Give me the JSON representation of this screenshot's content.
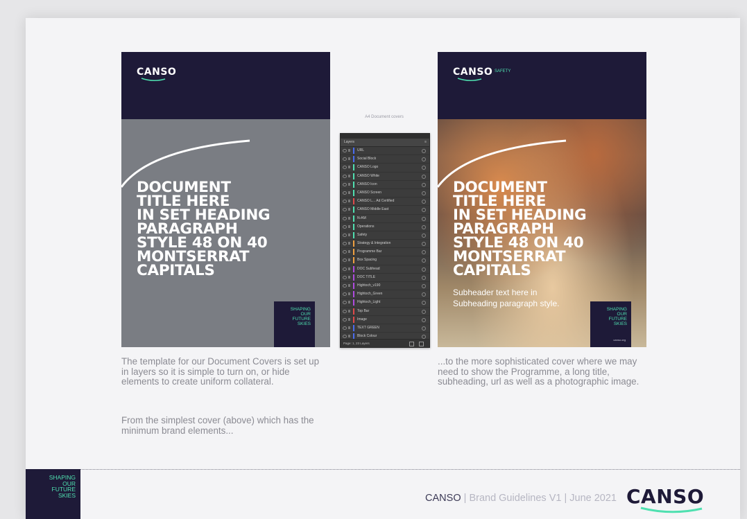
{
  "colors": {
    "navy": "#1e1a38",
    "green": "#4fe0b0",
    "cover_grey": "#7a7d83",
    "caption_grey": "#8b8b93"
  },
  "cover_simple": {
    "logo": "CANSO",
    "title": "DOCUMENT\nTITLE HERE\nIN SET HEADING\nPARAGRAPH\nSTYLE 48 ON 40\nMONTSERRAT\nCAPITALS",
    "badge": "SHAPING\nOUR\nFUTURE\nSKIES"
  },
  "cover_photo": {
    "logo": "CANSO",
    "logo_sub": "SAFETY",
    "title": "DOCUMENT\nTITLE HERE\nIN SET HEADING\nPARAGRAPH\nSTYLE 48 ON 40\nMONTSERRAT\nCAPITALS",
    "subheading": "Subheader text here in\nSubheading paragraph style.",
    "badge": "SHAPING\nOUR\nFUTURE\nSKIES",
    "badge_url": "canso.org"
  },
  "layers_panel": {
    "caption": "A4 Document covers",
    "tab_label": "Layers",
    "menu_icon": "menu-icon",
    "rows": [
      {
        "name": "URL",
        "color": "#4a6cf0"
      },
      {
        "name": "Social Block",
        "color": "#4a6cf0"
      },
      {
        "name": "CANSO Logo",
        "color": "#4fe0b0"
      },
      {
        "name": "CANSO White",
        "color": "#4fe0b0"
      },
      {
        "name": "CANSO Icon",
        "color": "#4fe0b0"
      },
      {
        "name": "CANSO Screen",
        "color": "#4fe0b0"
      },
      {
        "name": "CANSO L... Ad Certified",
        "color": "#e04a4a"
      },
      {
        "name": "CANSO Middle East",
        "color": "#4fe0b0"
      },
      {
        "name": "N-AM",
        "color": "#4fe0b0"
      },
      {
        "name": "Operations",
        "color": "#4fe0b0"
      },
      {
        "name": "Safety",
        "color": "#4fe0b0"
      },
      {
        "name": "Strategy & Integration",
        "color": "#f0a040"
      },
      {
        "name": "Programme Bar",
        "color": "#f0a040"
      },
      {
        "name": "Box Spacing",
        "color": "#f0a040"
      },
      {
        "name": "DOC Subhead",
        "color": "#b04ae0"
      },
      {
        "name": "DOC TITLE",
        "color": "#b04ae0"
      },
      {
        "name": "Hightoch_v190",
        "color": "#b04ae0"
      },
      {
        "name": "Hightoch_Green",
        "color": "#b04ae0"
      },
      {
        "name": "Hightoch_Light",
        "color": "#b04ae0"
      },
      {
        "name": "Top Bar",
        "color": "#e04a4a"
      },
      {
        "name": "Image",
        "color": "#e04a4a"
      },
      {
        "name": "TEXT GREEN",
        "color": "#4a6cf0"
      },
      {
        "name": "Block Colour",
        "color": "#4a6cf0"
      }
    ],
    "footer": "Page: 1, 23 Layers"
  },
  "captions": {
    "left_1": "The template for our Document Covers is set up in layers so it is simple to turn on, or hide elements to create uniform collateral.",
    "left_2": "From the simplest cover (above) which has the minimum brand elements...",
    "right": "...to the more sophisticated cover where we may need to show the Programme, a long title, subheading, url as well as a photographic image."
  },
  "footer": {
    "badge": "SHAPING\nOUR\nFUTURE\nSKIES",
    "brand": "CANSO",
    "separator_1": " | ",
    "doc_name": "Brand Guidelines V1",
    "separator_2": " | ",
    "date": "June 2021",
    "logo": "CANSO"
  }
}
